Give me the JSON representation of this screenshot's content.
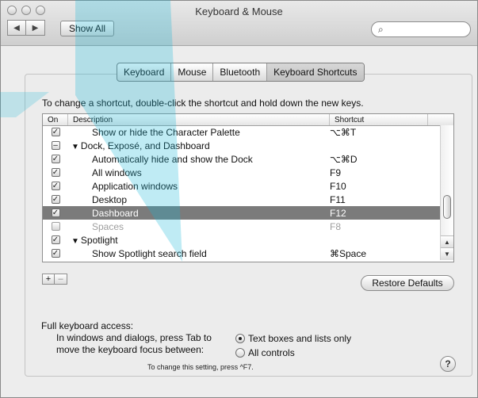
{
  "window": {
    "title": "Keyboard & Mouse",
    "nav_back_icon": "left-triangle",
    "nav_forward_icon": "right-triangle",
    "show_all_label": "Show All",
    "search_placeholder": "",
    "search_icon": "search-icon"
  },
  "tabs": [
    {
      "label": "Keyboard",
      "active": false
    },
    {
      "label": "Mouse",
      "active": false
    },
    {
      "label": "Bluetooth",
      "active": false
    },
    {
      "label": "Keyboard Shortcuts",
      "active": true
    }
  ],
  "instruction": "To change a shortcut, double-click the shortcut and hold down the new keys.",
  "table": {
    "headers": {
      "on": "On",
      "description": "Description",
      "shortcut": "Shortcut"
    },
    "rows": [
      {
        "check": "checked",
        "level": 1,
        "disclosure": "",
        "description": "Show or hide the Character Palette",
        "shortcut": "⌥⌘T",
        "selected": false,
        "disabled": false
      },
      {
        "check": "mixed",
        "level": 0,
        "disclosure": "▼",
        "description": "Dock, Exposé, and Dashboard",
        "shortcut": "",
        "selected": false,
        "disabled": false
      },
      {
        "check": "checked",
        "level": 1,
        "disclosure": "",
        "description": "Automatically hide and show the Dock",
        "shortcut": "⌥⌘D",
        "selected": false,
        "disabled": false
      },
      {
        "check": "checked",
        "level": 1,
        "disclosure": "",
        "description": "All windows",
        "shortcut": "F9",
        "selected": false,
        "disabled": false
      },
      {
        "check": "checked",
        "level": 1,
        "disclosure": "",
        "description": "Application windows",
        "shortcut": "F10",
        "selected": false,
        "disabled": false
      },
      {
        "check": "checked",
        "level": 1,
        "disclosure": "",
        "description": "Desktop",
        "shortcut": "F11",
        "selected": false,
        "disabled": false
      },
      {
        "check": "checked",
        "level": 1,
        "disclosure": "",
        "description": "Dashboard",
        "shortcut": "F12",
        "selected": true,
        "disabled": false
      },
      {
        "check": "empty",
        "level": 1,
        "disclosure": "",
        "description": "Spaces",
        "shortcut": "F8",
        "selected": false,
        "disabled": true
      },
      {
        "check": "checked",
        "level": 0,
        "disclosure": "▼",
        "description": "Spotlight",
        "shortcut": "",
        "selected": false,
        "disabled": false
      },
      {
        "check": "checked",
        "level": 1,
        "disclosure": "",
        "description": "Show Spotlight search field",
        "shortcut": "⌘Space",
        "selected": false,
        "disabled": false
      }
    ]
  },
  "buttons": {
    "add": "+",
    "remove": "–",
    "restore_defaults": "Restore Defaults",
    "help": "?"
  },
  "keyboard_access": {
    "label": "Full keyboard access:",
    "description": "In windows and dialogs, press Tab to move the keyboard focus between:",
    "options": [
      {
        "label": "Text boxes and lists only",
        "selected": true
      },
      {
        "label": "All controls",
        "selected": false
      }
    ],
    "hint": "To change this setting, press ^F7."
  },
  "colors": {
    "selected_row": "#7b7b7b",
    "deco_blue": "#18b6d6"
  }
}
